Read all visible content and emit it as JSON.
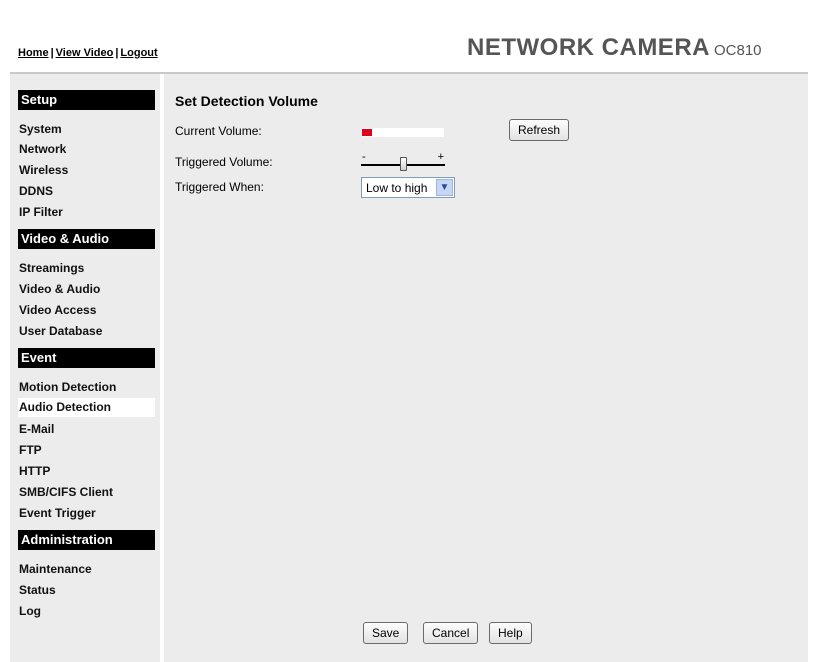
{
  "header": {
    "links": [
      "Home",
      "View Video",
      "Logout"
    ],
    "brand": "NETWORK CAMERA",
    "model": "OC810"
  },
  "sidebar": {
    "sections": [
      {
        "title": "Setup",
        "items": [
          "System",
          "Network",
          "Wireless",
          "DDNS",
          "IP Filter"
        ]
      },
      {
        "title": "Video & Audio",
        "items": [
          "Streamings",
          "Video & Audio",
          "Video Access",
          "User Database"
        ]
      },
      {
        "title": "Event",
        "items": [
          "Motion Detection",
          "Audio Detection",
          "E-Mail",
          "FTP",
          "HTTP",
          "SMB/CIFS Client",
          "Event Trigger"
        ]
      },
      {
        "title": "Administration",
        "items": [
          "Maintenance",
          "Status",
          "Log"
        ]
      }
    ],
    "active_item": "Audio Detection"
  },
  "main": {
    "title": "Set Detection Volume",
    "current_volume_label": "Current Volume:",
    "current_volume_level": 0.12,
    "triggered_volume_label": "Triggered Volume:",
    "triggered_volume_min_symbol": "-",
    "triggered_volume_max_symbol": "+",
    "triggered_volume_level": 0.5,
    "triggered_when_label": "Triggered When:",
    "triggered_when_value": "Low to high",
    "refresh_label": "Refresh"
  },
  "footer": {
    "save_label": "Save",
    "cancel_label": "Cancel",
    "help_label": "Help"
  },
  "colors": {
    "volume_indicator": "#e0001c",
    "section_header": "#000000",
    "panel_background": "#ececec"
  }
}
